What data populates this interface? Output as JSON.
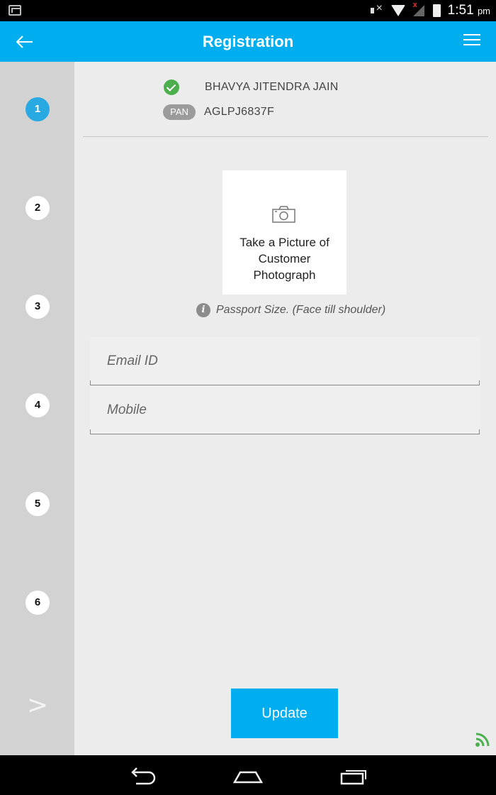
{
  "status_bar": {
    "time": "1:51",
    "ampm": "pm",
    "icons": [
      "gmail-icon",
      "mute-icon",
      "wifi-icon",
      "signal-icon",
      "battery-icon"
    ]
  },
  "app_bar": {
    "title": "Registration",
    "back_icon": "arrow-left-icon",
    "menu_icon": "hamburger-menu-icon",
    "color": "#00aeef"
  },
  "sidebar": {
    "steps": [
      {
        "label": "1",
        "active": true
      },
      {
        "label": "2",
        "active": false
      },
      {
        "label": "3",
        "active": false
      },
      {
        "label": "4",
        "active": false
      },
      {
        "label": "5",
        "active": false
      },
      {
        "label": "6",
        "active": false
      }
    ],
    "next_label": ">",
    "active_color": "#29a9e1"
  },
  "customer": {
    "name": "BHAVYA JITENDRA JAIN",
    "verified": true,
    "pan_badge": "PAN",
    "pan_number": "AGLPJ6837F"
  },
  "photo": {
    "label": "Take a Picture of Customer Photograph",
    "icon": "camera-icon",
    "hint": "Passport Size. (Face till shoulder)"
  },
  "form": {
    "email": {
      "placeholder": "Email ID",
      "value": ""
    },
    "mobile": {
      "placeholder": "Mobile",
      "value": ""
    }
  },
  "actions": {
    "update_label": "Update"
  },
  "nav_bar": {
    "icons": [
      "back-nav-icon",
      "home-nav-icon",
      "recents-nav-icon"
    ]
  }
}
